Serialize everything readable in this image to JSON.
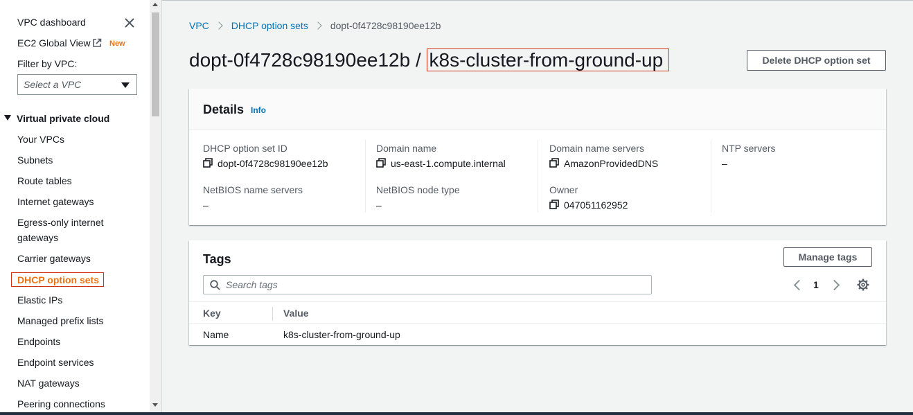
{
  "colors": {
    "link": "#0073bb",
    "accent": "#ec7211",
    "highlight_border": "#d13212"
  },
  "sidebar": {
    "dashboard": "VPC dashboard",
    "global_view": "EC2 Global View",
    "global_view_badge": "New",
    "filter_label": "Filter by VPC:",
    "filter_placeholder": "Select a VPC",
    "section": "Virtual private cloud",
    "items": [
      "Your VPCs",
      "Subnets",
      "Route tables",
      "Internet gateways",
      "Egress-only internet",
      "gateways",
      "Carrier gateways",
      "DHCP option sets",
      "Elastic IPs",
      "Managed prefix lists",
      "Endpoints",
      "Endpoint services",
      "NAT gateways",
      "Peering connections"
    ],
    "active_item": "DHCP option sets",
    "icons": {
      "close": "close-icon",
      "external": "external-link-icon",
      "collapse": "caret-down-icon"
    }
  },
  "breadcrumb": {
    "root": "VPC",
    "parent": "DHCP option sets",
    "current": "dopt-0f4728c98190ee12b"
  },
  "page": {
    "title_id": "dopt-0f4728c98190ee12b",
    "title_sep": "/",
    "title_name": "k8s-cluster-from-ground-up",
    "delete_button": "Delete DHCP option set"
  },
  "details": {
    "heading": "Details",
    "info": "Info",
    "fields": {
      "id_label": "DHCP option set ID",
      "id_value": "dopt-0f4728c98190ee12b",
      "domain_label": "Domain name",
      "domain_value": "us-east-1.compute.internal",
      "dns_label": "Domain name servers",
      "dns_value": "AmazonProvidedDNS",
      "ntp_label": "NTP servers",
      "ntp_value": "–",
      "netbios_ns_label": "NetBIOS name servers",
      "netbios_ns_value": "–",
      "netbios_nt_label": "NetBIOS node type",
      "netbios_nt_value": "–",
      "owner_label": "Owner",
      "owner_value": "047051162952"
    }
  },
  "tags": {
    "heading": "Tags",
    "manage_button": "Manage tags",
    "search_placeholder": "Search tags",
    "page": "1",
    "columns": {
      "key": "Key",
      "value": "Value"
    },
    "rows": [
      {
        "key": "Name",
        "value": "k8s-cluster-from-ground-up"
      }
    ]
  }
}
